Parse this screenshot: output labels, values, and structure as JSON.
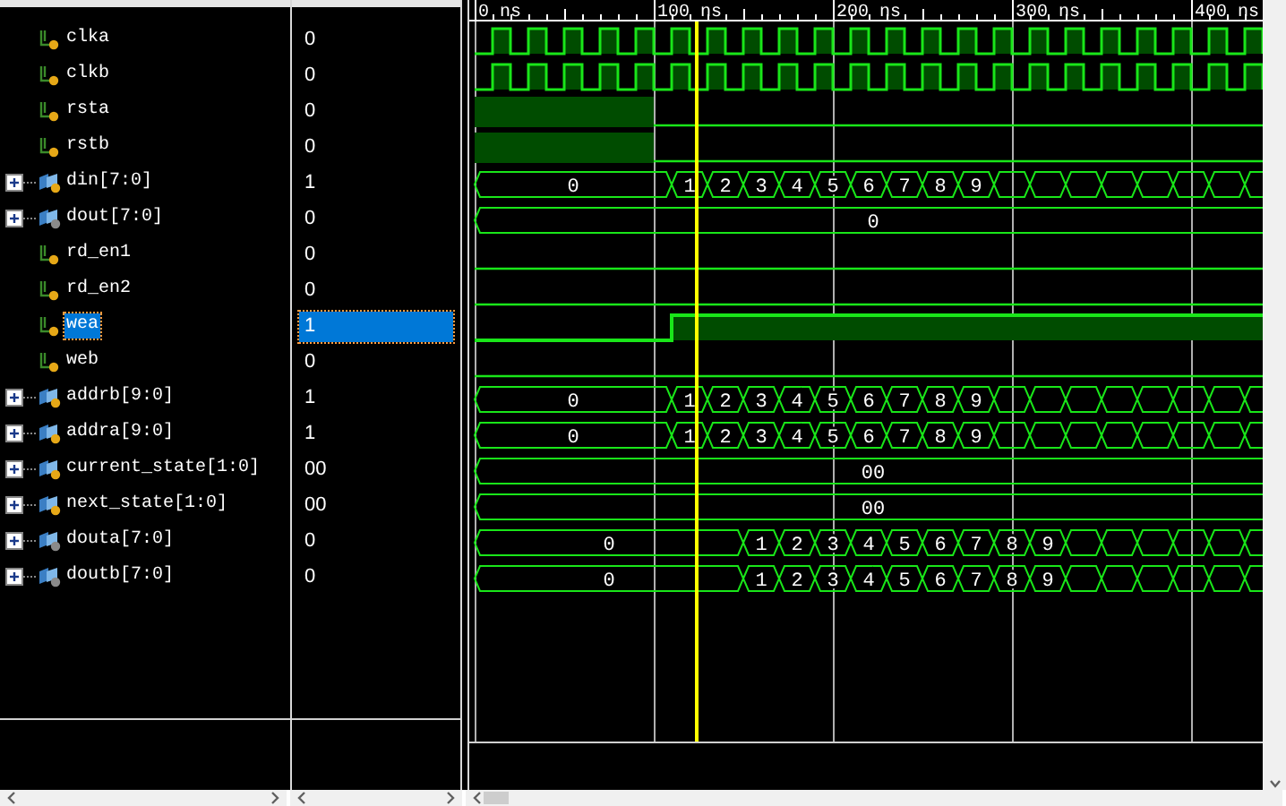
{
  "ruler": {
    "labels": [
      "0 ns",
      "100 ns",
      "200 ns",
      "300 ns",
      "400 ns"
    ]
  },
  "signals": [
    {
      "name": "clka",
      "value": "0",
      "kind": "bit",
      "output": false,
      "selected": false,
      "wave": {
        "kind": "clock"
      }
    },
    {
      "name": "clkb",
      "value": "0",
      "kind": "bit",
      "output": false,
      "selected": false,
      "wave": {
        "kind": "clock"
      }
    },
    {
      "name": "rsta",
      "value": "0",
      "kind": "bit",
      "output": false,
      "selected": false,
      "wave": {
        "kind": "reset"
      }
    },
    {
      "name": "rstb",
      "value": "0",
      "kind": "bit",
      "output": false,
      "selected": false,
      "wave": {
        "kind": "reset"
      }
    },
    {
      "name": "din[7:0]",
      "value": "1",
      "kind": "bus",
      "expanded": false,
      "output": false,
      "selected": false,
      "wave": {
        "kind": "bus_early",
        "segments": [
          "0",
          "1",
          "2",
          "3",
          "4",
          "5",
          "6",
          "7",
          "8",
          "9"
        ]
      }
    },
    {
      "name": "dout[7:0]",
      "value": "0",
      "kind": "bus",
      "expanded": false,
      "output": true,
      "selected": false,
      "wave": {
        "kind": "bus_const",
        "segments": [
          "0"
        ]
      }
    },
    {
      "name": "rd_en1",
      "value": "0",
      "kind": "bit",
      "output": false,
      "selected": false,
      "wave": {
        "kind": "low"
      }
    },
    {
      "name": "rd_en2",
      "value": "0",
      "kind": "bit",
      "output": false,
      "selected": false,
      "wave": {
        "kind": "low"
      }
    },
    {
      "name": "wea",
      "value": "1",
      "kind": "bit",
      "output": false,
      "selected": true,
      "wave": {
        "kind": "enable"
      }
    },
    {
      "name": "web",
      "value": "0",
      "kind": "bit",
      "output": false,
      "selected": false,
      "wave": {
        "kind": "low"
      }
    },
    {
      "name": "addrb[9:0]",
      "value": "1",
      "kind": "bus",
      "expanded": false,
      "output": false,
      "selected": false,
      "wave": {
        "kind": "bus_early",
        "segments": [
          "0",
          "1",
          "2",
          "3",
          "4",
          "5",
          "6",
          "7",
          "8",
          "9"
        ]
      }
    },
    {
      "name": "addra[9:0]",
      "value": "1",
      "kind": "bus",
      "expanded": false,
      "output": false,
      "selected": false,
      "wave": {
        "kind": "bus_early",
        "segments": [
          "0",
          "1",
          "2",
          "3",
          "4",
          "5",
          "6",
          "7",
          "8",
          "9"
        ]
      }
    },
    {
      "name": "current_state[1:0]",
      "value": "00",
      "kind": "bus",
      "expanded": false,
      "output": false,
      "selected": false,
      "wave": {
        "kind": "bus_const",
        "segments": [
          "00"
        ]
      }
    },
    {
      "name": "next_state[1:0]",
      "value": "00",
      "kind": "bus",
      "expanded": false,
      "output": false,
      "selected": false,
      "wave": {
        "kind": "bus_const",
        "segments": [
          "00"
        ]
      }
    },
    {
      "name": "douta[7:0]",
      "value": "0",
      "kind": "bus",
      "expanded": false,
      "output": true,
      "selected": false,
      "wave": {
        "kind": "bus_late",
        "segments": [
          "0",
          "1",
          "2",
          "3",
          "4",
          "5",
          "6",
          "7",
          "8",
          "9"
        ]
      }
    },
    {
      "name": "doutb[7:0]",
      "value": "0",
      "kind": "bus",
      "expanded": false,
      "output": true,
      "selected": false,
      "wave": {
        "kind": "bus_late",
        "segments": [
          "0",
          "1",
          "2",
          "3",
          "4",
          "5",
          "6",
          "7",
          "8",
          "9"
        ]
      }
    }
  ]
}
